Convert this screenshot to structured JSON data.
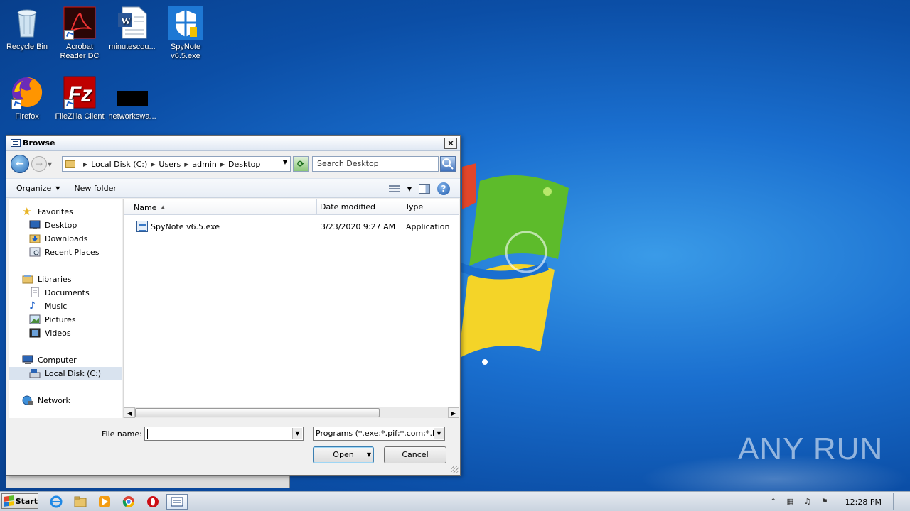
{
  "desktop": {
    "icons": [
      {
        "label": "Recycle Bin"
      },
      {
        "label": "Acrobat Reader DC"
      },
      {
        "label": "minutescou..."
      },
      {
        "label": "SpyNote v6.5.exe"
      },
      {
        "label": "Firefox"
      },
      {
        "label": "FileZilla Client"
      },
      {
        "label": "networkswa..."
      }
    ],
    "watermark": "ANY RUN"
  },
  "dialog": {
    "title": "Browse",
    "address": {
      "crumbs": [
        "Local Disk (C:)",
        "Users",
        "admin",
        "Desktop"
      ]
    },
    "search_placeholder": "Search Desktop",
    "toolbar": {
      "organize": "Organize",
      "new_folder": "New folder"
    },
    "nav": {
      "favorites": "Favorites",
      "desktop": "Desktop",
      "downloads": "Downloads",
      "recent_places": "Recent Places",
      "libraries": "Libraries",
      "documents": "Documents",
      "music": "Music",
      "pictures": "Pictures",
      "videos": "Videos",
      "computer": "Computer",
      "local_disk": "Local Disk (C:)",
      "network": "Network"
    },
    "columns": {
      "name": "Name",
      "date_modified": "Date modified",
      "type": "Type"
    },
    "files": [
      {
        "name": "SpyNote v6.5.exe",
        "date": "3/23/2020 9:27 AM",
        "type": "Application"
      }
    ],
    "file_name_label": "File name:",
    "file_name_value": "",
    "filter": "Programs (*.exe;*.pif;*.com;*.ba",
    "open_label": "Open",
    "cancel_label": "Cancel"
  },
  "taskbar": {
    "start": "Start",
    "clock": "12:28 PM"
  },
  "colors": {
    "desktop_blue": "#1a6fcf",
    "dialog_bg": "#f0f0f0",
    "selection": "#d9e3ef"
  }
}
